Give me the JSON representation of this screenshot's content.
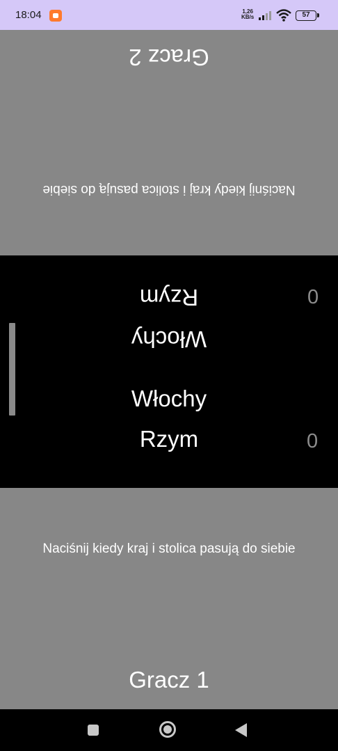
{
  "status_bar": {
    "time": "18:04",
    "net_speed_value": "1,26",
    "net_speed_unit": "KB/s",
    "battery": "57"
  },
  "player2": {
    "name": "Gracz 2",
    "hint": "Naciśnij kiedy kraj i stolica pasują do siebie"
  },
  "player1": {
    "name": "Gracz 1",
    "hint": "Naciśnij kiedy kraj i stolica pasują do siebie"
  },
  "middle": {
    "country_flipped": "Włochy",
    "capital_flipped": "Rzym",
    "country": "Włochy",
    "capital": "Rzym",
    "score_player2": "0",
    "score_player1": "0"
  },
  "nav": {
    "icons": [
      "recents-icon",
      "home-icon",
      "back-icon"
    ]
  }
}
